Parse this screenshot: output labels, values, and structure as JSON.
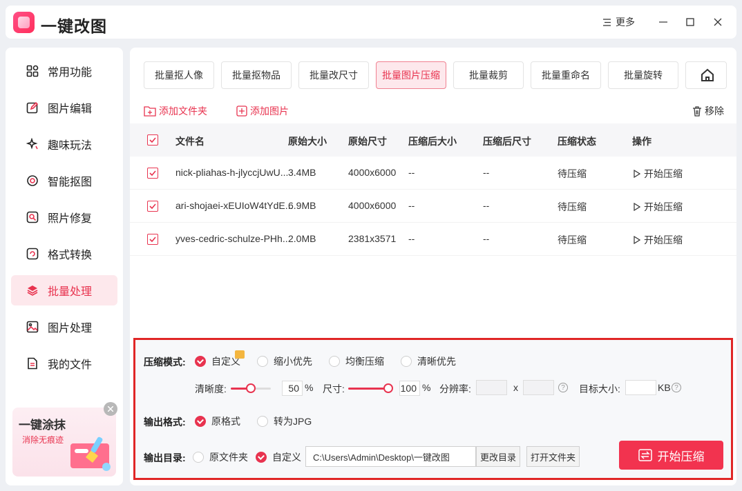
{
  "app": {
    "title": "一键改图",
    "more_label": "更多"
  },
  "sidebar": {
    "items": [
      {
        "label": "常用功能",
        "icon": "grid-icon"
      },
      {
        "label": "图片编辑",
        "icon": "edit-icon"
      },
      {
        "label": "趣味玩法",
        "icon": "sparkle-icon"
      },
      {
        "label": "智能抠图",
        "icon": "target-icon"
      },
      {
        "label": "照片修复",
        "icon": "repair-icon"
      },
      {
        "label": "格式转换",
        "icon": "convert-icon"
      },
      {
        "label": "批量处理",
        "icon": "layers-icon"
      },
      {
        "label": "图片处理",
        "icon": "image-icon"
      },
      {
        "label": "我的文件",
        "icon": "file-icon"
      }
    ],
    "active_index": 6,
    "promo": {
      "title": "一键涂抹",
      "subtitle": "消除无痕迹"
    }
  },
  "tabs": [
    "批量抠人像",
    "批量抠物品",
    "批量改尺寸",
    "批量图片压缩",
    "批量裁剪",
    "批量重命名",
    "批量旋转"
  ],
  "active_tab": 3,
  "actions": {
    "add_folder": "添加文件夹",
    "add_image": "添加图片",
    "remove": "移除"
  },
  "table": {
    "headers": [
      "文件名",
      "原始大小",
      "原始尺寸",
      "压缩后大小",
      "压缩后尺寸",
      "压缩状态",
      "操作"
    ],
    "rows": [
      {
        "name": "nick-pliahas-h-jlyccjUwU...",
        "size": "3.4MB",
        "dim": "4000x6000",
        "new_size": "--",
        "new_dim": "--",
        "status": "待压缩",
        "op": "开始压缩"
      },
      {
        "name": "ari-shojaei-xEUIoW4tYdE...",
        "size": "6.9MB",
        "dim": "4000x6000",
        "new_size": "--",
        "new_dim": "--",
        "status": "待压缩",
        "op": "开始压缩"
      },
      {
        "name": "yves-cedric-schulze-PHh...",
        "size": "2.0MB",
        "dim": "2381x3571",
        "new_size": "--",
        "new_dim": "--",
        "status": "待压缩",
        "op": "开始压缩"
      }
    ]
  },
  "settings": {
    "mode_label": "压缩模式:",
    "modes": [
      "自定义",
      "缩小优先",
      "均衡压缩",
      "清晰优先"
    ],
    "mode_selected": 0,
    "clarity_label": "清晰度:",
    "clarity_value": "50",
    "clarity_fraction": 0.5,
    "size_label": "尺寸:",
    "size_value": "100",
    "size_fraction": 1.0,
    "percent": "%",
    "resolution_label": "分辨率:",
    "x_label": "x",
    "target_label": "目标大小:",
    "kb_label": "KB",
    "format_label": "输出格式:",
    "formats": [
      "原格式",
      "转为JPG"
    ],
    "format_selected": 0,
    "dir_label": "输出目录:",
    "dirs": [
      "原文件夹",
      "自定义"
    ],
    "dir_selected": 1,
    "path": "C:\\Users\\Admin\\Desktop\\一键改图",
    "change_dir": "更改目录",
    "open_folder": "打开文件夹",
    "start": "开始压缩"
  },
  "colors": {
    "accent": "#e8334f",
    "highlight_border": "#e02626"
  }
}
